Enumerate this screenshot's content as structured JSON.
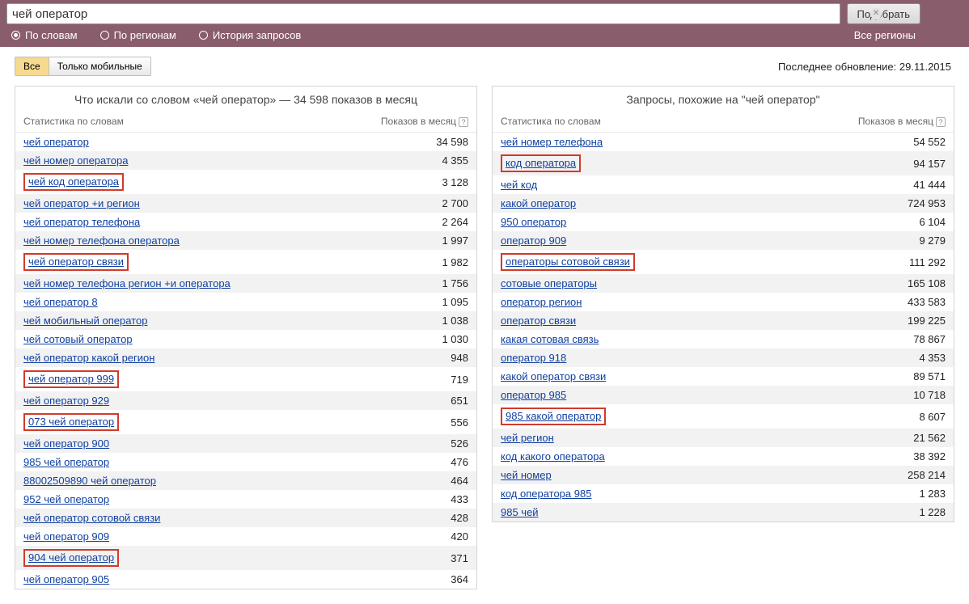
{
  "search": {
    "value": "чей оператор",
    "submit": "Подобрать"
  },
  "opts": {
    "by_words": "По словам",
    "by_regions": "По регионам",
    "history": "История запросов",
    "all_regions": "Все регионы"
  },
  "tabs": {
    "all": "Все",
    "mobile": "Только мобильные"
  },
  "updated": "Последнее обновление: 29.11.2015",
  "left": {
    "title": "Что искали со словом «чей оператор» — 34 598 показов в месяц",
    "col1": "Статистика по словам",
    "col2": "Показов в месяц",
    "rows": [
      {
        "q": "чей оператор",
        "n": "34 598",
        "hl": false
      },
      {
        "q": "чей номер оператора",
        "n": "4 355",
        "hl": false
      },
      {
        "q": "чей код оператора",
        "n": "3 128",
        "hl": true
      },
      {
        "q": "чей оператор +и регион",
        "n": "2 700",
        "hl": false
      },
      {
        "q": "чей оператор телефона",
        "n": "2 264",
        "hl": false
      },
      {
        "q": "чей номер телефона оператора",
        "n": "1 997",
        "hl": false
      },
      {
        "q": "чей оператор связи",
        "n": "1 982",
        "hl": true
      },
      {
        "q": "чей номер телефона регион +и оператора",
        "n": "1 756",
        "hl": false
      },
      {
        "q": "чей оператор 8",
        "n": "1 095",
        "hl": false
      },
      {
        "q": "чей мобильный оператор",
        "n": "1 038",
        "hl": false
      },
      {
        "q": "чей сотовый оператор",
        "n": "1 030",
        "hl": false
      },
      {
        "q": "чей оператор какой регион",
        "n": "948",
        "hl": false
      },
      {
        "q": "чей оператор 999",
        "n": "719",
        "hl": true
      },
      {
        "q": "чей оператор 929",
        "n": "651",
        "hl": false
      },
      {
        "q": "073 чей оператор",
        "n": "556",
        "hl": true
      },
      {
        "q": "чей оператор 900",
        "n": "526",
        "hl": false
      },
      {
        "q": "985 чей оператор",
        "n": "476",
        "hl": false
      },
      {
        "q": "88002509890 чей оператор",
        "n": "464",
        "hl": false
      },
      {
        "q": "952 чей оператор",
        "n": "433",
        "hl": false
      },
      {
        "q": "чей оператор сотовой связи",
        "n": "428",
        "hl": false
      },
      {
        "q": "чей оператор 909",
        "n": "420",
        "hl": false
      },
      {
        "q": "904 чей оператор",
        "n": "371",
        "hl": true
      },
      {
        "q": "чей оператор 905",
        "n": "364",
        "hl": false
      }
    ]
  },
  "right": {
    "title": "Запросы, похожие на \"чей оператор\"",
    "col1": "Статистика по словам",
    "col2": "Показов в месяц",
    "rows": [
      {
        "q": "чей номер телефона",
        "n": "54 552",
        "hl": false
      },
      {
        "q": "код оператора",
        "n": "94 157",
        "hl": true
      },
      {
        "q": "чей код",
        "n": "41 444",
        "hl": false
      },
      {
        "q": "какой оператор",
        "n": "724 953",
        "hl": false
      },
      {
        "q": "950 оператор",
        "n": "6 104",
        "hl": false
      },
      {
        "q": "оператор 909",
        "n": "9 279",
        "hl": false
      },
      {
        "q": "операторы сотовой связи",
        "n": "111 292",
        "hl": true
      },
      {
        "q": "сотовые операторы",
        "n": "165 108",
        "hl": false
      },
      {
        "q": "оператор регион",
        "n": "433 583",
        "hl": false
      },
      {
        "q": "оператор связи",
        "n": "199 225",
        "hl": false
      },
      {
        "q": "какая сотовая связь",
        "n": "78 867",
        "hl": false
      },
      {
        "q": "оператор 918",
        "n": "4 353",
        "hl": false
      },
      {
        "q": "какой оператор связи",
        "n": "89 571",
        "hl": false
      },
      {
        "q": "оператор 985",
        "n": "10 718",
        "hl": false
      },
      {
        "q": "985 какой оператор",
        "n": "8 607",
        "hl": true
      },
      {
        "q": "чей регион",
        "n": "21 562",
        "hl": false
      },
      {
        "q": "код какого оператора",
        "n": "38 392",
        "hl": false
      },
      {
        "q": "чей номер",
        "n": "258 214",
        "hl": false
      },
      {
        "q": "код оператора 985",
        "n": "1 283",
        "hl": false
      },
      {
        "q": "985 чей",
        "n": "1 228",
        "hl": false
      }
    ]
  }
}
